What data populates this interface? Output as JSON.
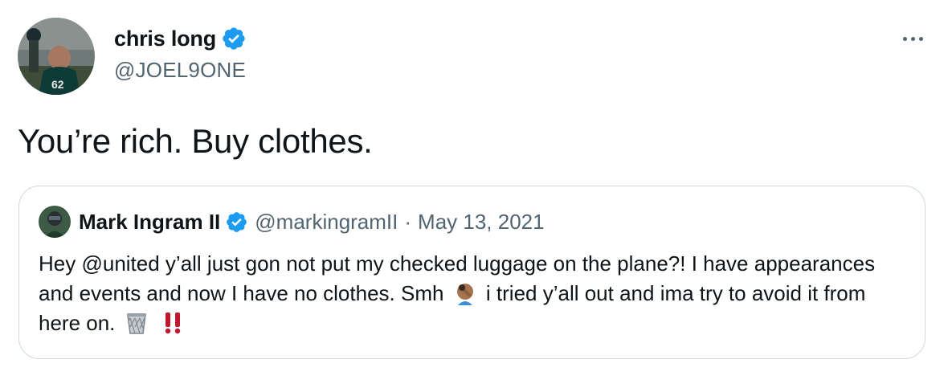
{
  "tweet": {
    "author": {
      "display_name": "chris long",
      "handle": "@JOEL9ONE",
      "avatar_icon": "avatar-photo-football-player",
      "verified_icon": "verified-badge-icon"
    },
    "more_icon": "more-options-icon",
    "text": "You’re rich. Buy clothes."
  },
  "quote": {
    "author": {
      "display_name": "Mark Ingram II",
      "handle": "@markingramII",
      "separator": "·",
      "date": "May 13, 2021",
      "avatar_icon": "avatar-photo-football-player",
      "verified_icon": "verified-badge-icon"
    },
    "text_part1": "Hey @united y’all just gon not put my checked luggage on the plane?! I have appearances and events and now I have no clothes. Smh",
    "text_part2": "i tried y’all out and ima try to avoid it from here on.",
    "emojis": [
      "facepalm-emoji",
      "wastebasket-emoji",
      "double-exclamation-emoji"
    ]
  },
  "colors": {
    "text_primary": "#0f1419",
    "text_secondary": "#536471",
    "border": "#cfd9de",
    "verified_blue": "#1d9bf0",
    "exclamation_red": "#be1931"
  }
}
